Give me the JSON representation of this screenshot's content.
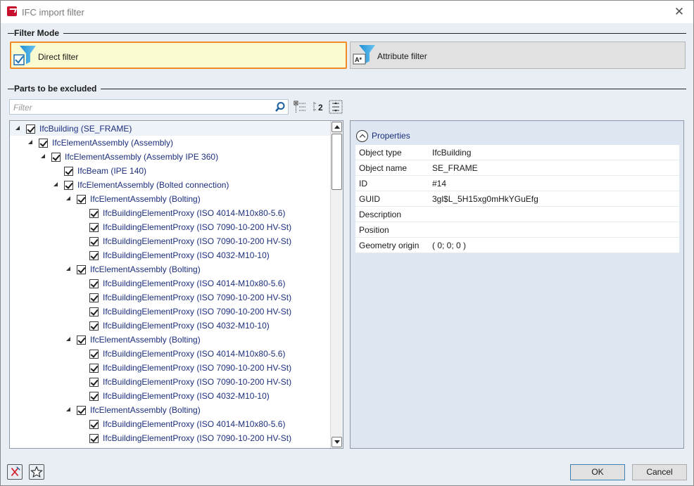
{
  "window": {
    "title": "IFC import filter"
  },
  "filter_mode": {
    "section_title": "Filter Mode",
    "buttons": [
      {
        "label": "Direct filter",
        "active": true
      },
      {
        "label": "Attribute filter",
        "active": false
      }
    ]
  },
  "parts": {
    "section_title": "Parts to be excluded",
    "filter_placeholder": "Filter",
    "filter_value": "",
    "tree": [
      {
        "label": "IfcBuilding (SE_FRAME)",
        "level": 0,
        "expanded": true,
        "checked": true,
        "selected": true
      },
      {
        "label": "IfcElementAssembly (Assembly)",
        "level": 1,
        "expanded": true,
        "checked": true
      },
      {
        "label": "IfcElementAssembly (Assembly IPE 360)",
        "level": 2,
        "expanded": true,
        "checked": true
      },
      {
        "label": "IfcBeam (IPE 140)",
        "level": 3,
        "expanded": null,
        "checked": true
      },
      {
        "label": "IfcElementAssembly (Bolted connection)",
        "level": 3,
        "expanded": true,
        "checked": true
      },
      {
        "label": "IfcElementAssembly (Bolting)",
        "level": 4,
        "expanded": true,
        "checked": true
      },
      {
        "label": "IfcBuildingElementProxy (ISO 4014-M10x80-5.6)",
        "level": 5,
        "expanded": null,
        "checked": true
      },
      {
        "label": "IfcBuildingElementProxy (ISO 7090-10-200 HV-St)",
        "level": 5,
        "expanded": null,
        "checked": true
      },
      {
        "label": "IfcBuildingElementProxy (ISO 7090-10-200 HV-St)",
        "level": 5,
        "expanded": null,
        "checked": true
      },
      {
        "label": "IfcBuildingElementProxy (ISO 4032-M10-10)",
        "level": 5,
        "expanded": null,
        "checked": true
      },
      {
        "label": "IfcElementAssembly (Bolting)",
        "level": 4,
        "expanded": true,
        "checked": true
      },
      {
        "label": "IfcBuildingElementProxy (ISO 4014-M10x80-5.6)",
        "level": 5,
        "expanded": null,
        "checked": true
      },
      {
        "label": "IfcBuildingElementProxy (ISO 7090-10-200 HV-St)",
        "level": 5,
        "expanded": null,
        "checked": true
      },
      {
        "label": "IfcBuildingElementProxy (ISO 7090-10-200 HV-St)",
        "level": 5,
        "expanded": null,
        "checked": true
      },
      {
        "label": "IfcBuildingElementProxy (ISO 4032-M10-10)",
        "level": 5,
        "expanded": null,
        "checked": true
      },
      {
        "label": "IfcElementAssembly (Bolting)",
        "level": 4,
        "expanded": true,
        "checked": true
      },
      {
        "label": "IfcBuildingElementProxy (ISO 4014-M10x80-5.6)",
        "level": 5,
        "expanded": null,
        "checked": true
      },
      {
        "label": "IfcBuildingElementProxy (ISO 7090-10-200 HV-St)",
        "level": 5,
        "expanded": null,
        "checked": true
      },
      {
        "label": "IfcBuildingElementProxy (ISO 7090-10-200 HV-St)",
        "level": 5,
        "expanded": null,
        "checked": true
      },
      {
        "label": "IfcBuildingElementProxy (ISO 4032-M10-10)",
        "level": 5,
        "expanded": null,
        "checked": true
      },
      {
        "label": "IfcElementAssembly (Bolting)",
        "level": 4,
        "expanded": true,
        "checked": true
      },
      {
        "label": "IfcBuildingElementProxy (ISO 4014-M10x80-5.6)",
        "level": 5,
        "expanded": null,
        "checked": true
      },
      {
        "label": "IfcBuildingElementProxy (ISO 7090-10-200 HV-St)",
        "level": 5,
        "expanded": null,
        "checked": true
      }
    ]
  },
  "properties": {
    "title": "Properties",
    "rows": [
      {
        "key": "Object type",
        "value": "IfcBuilding"
      },
      {
        "key": "Object name",
        "value": "SE_FRAME"
      },
      {
        "key": "ID",
        "value": "#14"
      },
      {
        "key": "GUID",
        "value": "3gl$L_5H15xg0mHkYGuEfg"
      },
      {
        "key": "Description",
        "value": ""
      },
      {
        "key": "Position",
        "value": ""
      },
      {
        "key": "Geometry origin",
        "value": "( 0; 0; 0 )"
      }
    ]
  },
  "footer": {
    "ok_label": "OK",
    "cancel_label": "Cancel"
  },
  "colors": {
    "accent_orange": "#f08a24",
    "active_bg": "#fafad0",
    "tree_text": "#1c2f7c",
    "panel_bg": "#dde6f1",
    "window_bg": "#e9eef5"
  }
}
